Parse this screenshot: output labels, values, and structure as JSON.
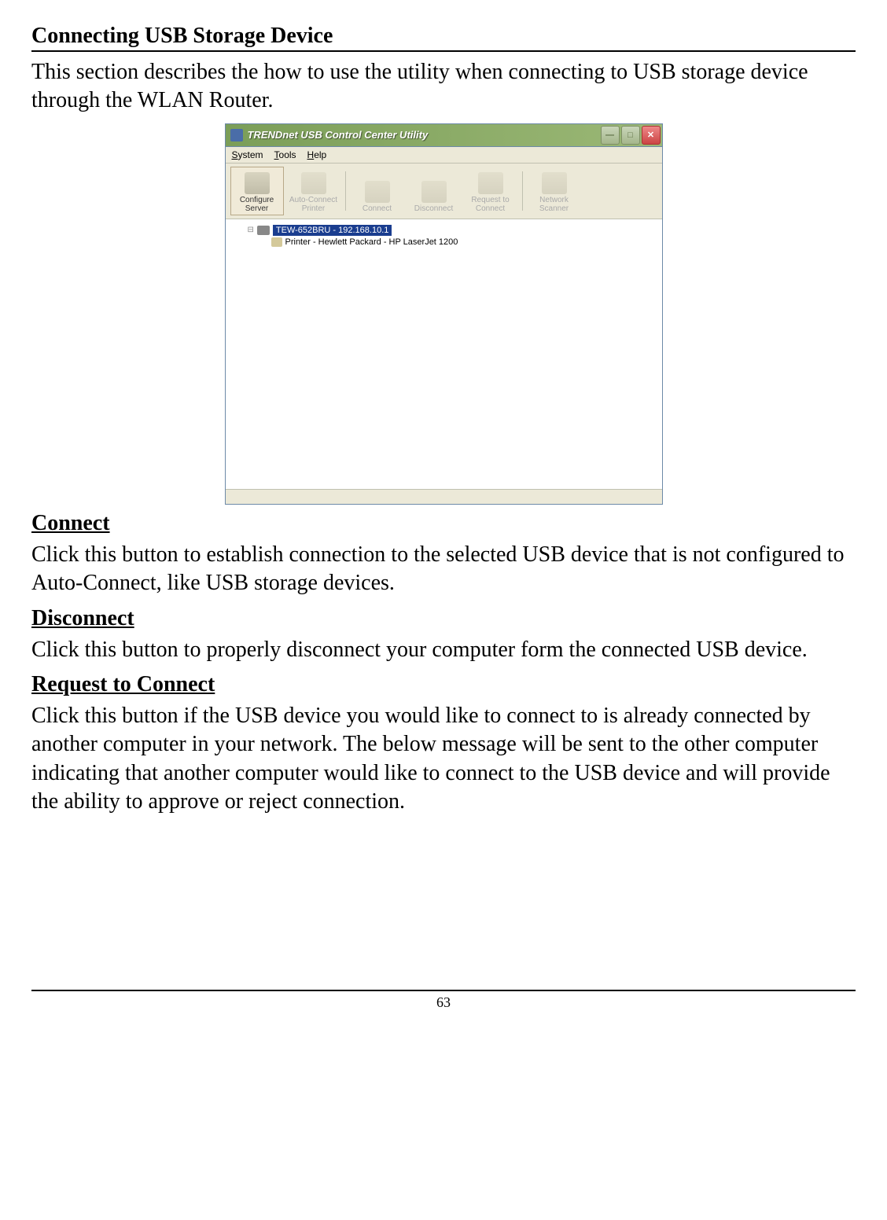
{
  "page": {
    "title": "Connecting USB Storage Device",
    "intro": "This section describes the how to use the utility when connecting to USB storage device through the WLAN Router.",
    "page_number": "63"
  },
  "window": {
    "title": "TRENDnet USB Control Center Utility",
    "menu": {
      "system": "System",
      "tools": "Tools",
      "help": "Help"
    },
    "toolbar": {
      "configure_server": "Configure Server",
      "auto_connect_printer": "Auto-Connect Printer",
      "connect": "Connect",
      "disconnect": "Disconnect",
      "request_to_connect": "Request to Connect",
      "network_scanner": "Network Scanner"
    },
    "tree": {
      "router": "TEW-652BRU - 192.168.10.1",
      "printer": "Printer - Hewlett Packard - HP LaserJet 1200"
    }
  },
  "sections": {
    "connect": {
      "heading": "Connect",
      "body": "Click this button to establish connection to the selected USB device that is not configured to Auto-Connect, like USB storage devices."
    },
    "disconnect": {
      "heading": "Disconnect",
      "body": "Click this button to properly disconnect your computer form the connected USB device."
    },
    "request": {
      "heading": "Request to Connect",
      "body": "Click this button if the USB device you would like to connect to is already connected by another computer in your network. The below message will be sent to the other computer indicating that another computer would like to connect to the USB device and will provide the ability to approve or reject connection."
    }
  }
}
